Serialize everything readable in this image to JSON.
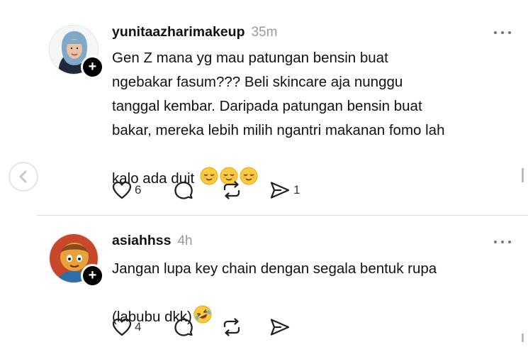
{
  "posts": [
    {
      "username": "yunitaazharimakeup",
      "time": "35m",
      "text": "Gen Z mana yg mau patungan bensin buat\nngebakar fasum??? Beli skincare aja nunggu\ntanggal kembar. Daripada patungan bensin buat\nbakar, mereka lebih milih ngantri makanan fomo lah\nkalo ada duit",
      "emojis": [
        "relieved-face-emoji",
        "relieved-face-emoji",
        "relieved-face-emoji"
      ],
      "like_count": "6",
      "comment_count": "",
      "repost_count": "",
      "share_count": "1"
    },
    {
      "username": "asiahhss",
      "time": "4h",
      "text": "Jangan lupa key chain dengan segala bentuk rupa\n(labubu dkk)",
      "emojis": [
        "rolling-on-floor-laughing-emoji"
      ],
      "like_count": "4",
      "comment_count": "",
      "repost_count": "",
      "share_count": ""
    }
  ],
  "icons": {
    "like": "heart-icon",
    "comment": "comment-icon",
    "repost": "repost-icon",
    "share": "share-icon",
    "more": "more-icon",
    "follow": "plus-icon",
    "nav_prev": "chevron-left-icon"
  },
  "colors": {
    "text": "#111111",
    "muted": "#9a9a9a",
    "divider": "#d9d9d9",
    "badge": "#000000"
  },
  "follow_symbol": "+"
}
